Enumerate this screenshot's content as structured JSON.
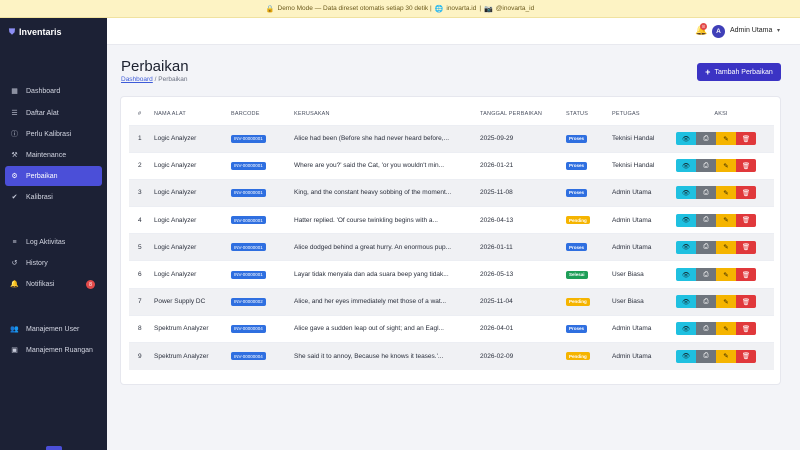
{
  "banner": {
    "text": "Demo Mode — Data direset otomatis setiap 30 detik | ",
    "site": "inovarta.id",
    "sep": " | ",
    "handle": "@inovarta_id"
  },
  "brand": {
    "name": "Inventaris"
  },
  "sidebar": {
    "items": [
      {
        "label": "Dashboard",
        "icon": "dashboard-icon"
      },
      {
        "label": "Daftar Alat",
        "icon": "list-icon"
      },
      {
        "label": "Perlu Kalibrasi",
        "icon": "alert-icon"
      },
      {
        "label": "Maintenance",
        "icon": "wrench-icon"
      },
      {
        "label": "Perbaikan",
        "icon": "repair-icon"
      },
      {
        "label": "Kalibrasi",
        "icon": "check-icon"
      },
      {
        "label": "Log Aktivitas",
        "icon": "activity-icon"
      },
      {
        "label": "History",
        "icon": "history-icon"
      },
      {
        "label": "Notifikasi",
        "icon": "bell-icon",
        "badge": "8"
      },
      {
        "label": "Manajemen User",
        "icon": "users-icon"
      },
      {
        "label": "Manajemen Ruangan",
        "icon": "room-icon"
      }
    ],
    "active": "Perbaikan"
  },
  "topbar": {
    "notif_count": "8",
    "avatar_initial": "A",
    "user_name": "Admin Utama"
  },
  "page": {
    "title": "Perbaikan",
    "breadcrumb_home": "Dashboard",
    "breadcrumb_sep": "/",
    "breadcrumb_current": "Perbaikan",
    "add_button": "Tambah Perbaikan"
  },
  "table": {
    "headers": [
      "#",
      "NAMA ALAT",
      "BARCODE",
      "KERUSAKAN",
      "TANGGAL PERBAIKAN",
      "STATUS",
      "PETUGAS",
      "AKSI"
    ],
    "rows": [
      {
        "no": "1",
        "alat": "Logic Analyzer",
        "barcode": "INV-00000001",
        "kerusakan": "Alice had been (Before she had never heard before,...",
        "tanggal": "2025-09-29",
        "status": "Proses",
        "petugas": "Teknisi Handal"
      },
      {
        "no": "2",
        "alat": "Logic Analyzer",
        "barcode": "INV-00000001",
        "kerusakan": "Where are you?' said the Cat, 'or you wouldn't min...",
        "tanggal": "2026-01-21",
        "status": "Proses",
        "petugas": "Teknisi Handal"
      },
      {
        "no": "3",
        "alat": "Logic Analyzer",
        "barcode": "INV-00000001",
        "kerusakan": "King, and the constant heavy sobbing of the moment...",
        "tanggal": "2025-11-08",
        "status": "Proses",
        "petugas": "Admin Utama"
      },
      {
        "no": "4",
        "alat": "Logic Analyzer",
        "barcode": "INV-00000001",
        "kerusakan": "Hatter replied. 'Of course twinkling begins with a...",
        "tanggal": "2026-04-13",
        "status": "Pending",
        "petugas": "Admin Utama"
      },
      {
        "no": "5",
        "alat": "Logic Analyzer",
        "barcode": "INV-00000001",
        "kerusakan": "Alice dodged behind a great hurry. An enormous pup...",
        "tanggal": "2026-01-11",
        "status": "Proses",
        "petugas": "Admin Utama"
      },
      {
        "no": "6",
        "alat": "Logic Analyzer",
        "barcode": "INV-00000001",
        "kerusakan": "Layar tidak menyala dan ada suara beep yang tidak...",
        "tanggal": "2026-05-13",
        "status": "Selesai",
        "petugas": "User Biasa"
      },
      {
        "no": "7",
        "alat": "Power Supply DC",
        "barcode": "INV-00000002",
        "kerusakan": "Alice, and her eyes immediately met those of a wat...",
        "tanggal": "2025-11-04",
        "status": "Pending",
        "petugas": "User Biasa"
      },
      {
        "no": "8",
        "alat": "Spektrum Analyzer",
        "barcode": "INV-00000004",
        "kerusakan": "Alice gave a sudden leap out of sight; and an Eagl...",
        "tanggal": "2026-04-01",
        "status": "Proses",
        "petugas": "Admin Utama"
      },
      {
        "no": "9",
        "alat": "Spektrum Analyzer",
        "barcode": "INV-00000004",
        "kerusakan": "She said it to annoy, Because he knows it teases.'...",
        "tanggal": "2026-02-09",
        "status": "Pending",
        "petugas": "Admin Utama"
      }
    ]
  },
  "status_colors": {
    "Proses": "#2f6fe0",
    "Pending": "#f5b400",
    "Selesai": "#1e9e58"
  },
  "action_icons": [
    "view-icon",
    "print-icon",
    "edit-icon",
    "delete-icon"
  ]
}
